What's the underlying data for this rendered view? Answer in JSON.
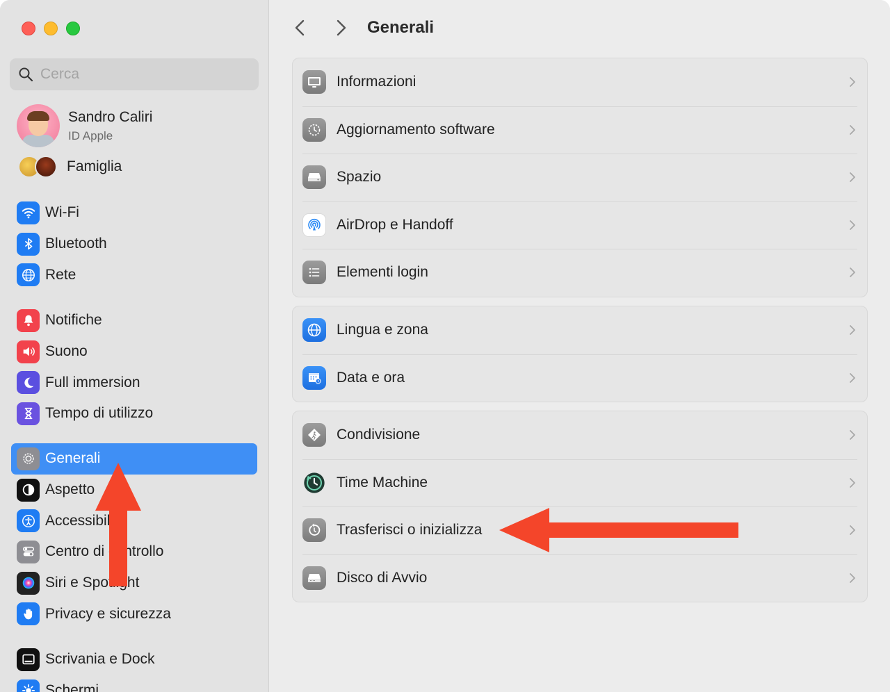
{
  "window": {
    "title": "Generali"
  },
  "search": {
    "placeholder": "Cerca"
  },
  "account": {
    "name": "Sandro Caliri",
    "subtitle": "ID Apple"
  },
  "family": {
    "label": "Famiglia"
  },
  "sidebar": {
    "group1": [
      {
        "label": "Wi-Fi",
        "icon": "wifi-icon",
        "color": "#1f7cf3"
      },
      {
        "label": "Bluetooth",
        "icon": "bluetooth-icon",
        "color": "#1f7cf3"
      },
      {
        "label": "Rete",
        "icon": "globe-icon",
        "color": "#1f7cf3"
      }
    ],
    "group2": [
      {
        "label": "Notifiche",
        "icon": "bell-icon",
        "color": "#f2424c"
      },
      {
        "label": "Suono",
        "icon": "speaker-icon",
        "color": "#f2424c"
      },
      {
        "label": "Full immersion",
        "icon": "moon-icon",
        "color": "#5b4fe0"
      },
      {
        "label": "Tempo di utilizzo",
        "icon": "hourglass-icon",
        "color": "#6a52e0"
      }
    ],
    "group3": [
      {
        "label": "Generali",
        "icon": "gear-icon",
        "color": "#8e8e93",
        "selected": true
      },
      {
        "label": "Aspetto",
        "icon": "appearance-icon",
        "color": "#111111"
      },
      {
        "label": "Accessibilità",
        "icon": "accessibility-icon",
        "color": "#1f7cf3"
      },
      {
        "label": "Centro di controllo",
        "icon": "toggles-icon",
        "color": "#8e8e93"
      },
      {
        "label": "Siri e Spotlight",
        "icon": "siri-icon",
        "color": "#222222"
      },
      {
        "label": "Privacy e sicurezza",
        "icon": "hand-icon",
        "color": "#1f7cf3"
      }
    ],
    "group4": [
      {
        "label": "Scrivania e Dock",
        "icon": "dock-icon",
        "color": "#111111"
      },
      {
        "label": "Schermi",
        "icon": "sun-icon",
        "color": "#1f7cf3"
      }
    ]
  },
  "main": {
    "groups": [
      [
        {
          "label": "Informazioni",
          "icon": "display-icon"
        },
        {
          "label": "Aggiornamento software",
          "icon": "software-update-gear-icon"
        },
        {
          "label": "Spazio",
          "icon": "storage-drive-icon"
        },
        {
          "label": "AirDrop e Handoff",
          "icon": "airdrop-icon"
        },
        {
          "label": "Elementi login",
          "icon": "list-icon"
        }
      ],
      [
        {
          "label": "Lingua e zona",
          "icon": "globe-icon"
        },
        {
          "label": "Data e ora",
          "icon": "calendar-clock-icon"
        }
      ],
      [
        {
          "label": "Condivisione",
          "icon": "sharing-diamond-icon"
        },
        {
          "label": "Time Machine",
          "icon": "time-machine-icon"
        },
        {
          "label": "Trasferisci o inizializza",
          "icon": "reset-icon"
        },
        {
          "label": "Disco di Avvio",
          "icon": "startup-disk-icon"
        }
      ]
    ]
  },
  "annotations": {
    "arrow_color": "#f4452a"
  }
}
